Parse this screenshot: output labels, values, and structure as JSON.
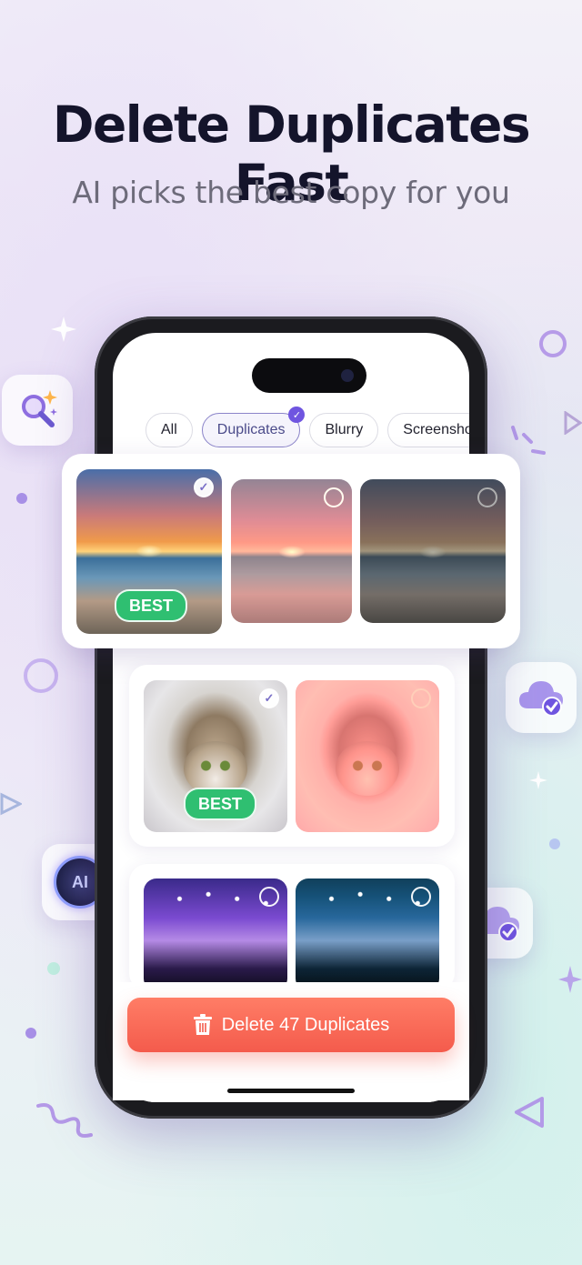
{
  "headline": "Delete Duplicates Fast",
  "subheadline": "AI picks the best copy for you",
  "filters": [
    {
      "label": "All",
      "active": false
    },
    {
      "label": "Duplicates",
      "active": true
    },
    {
      "label": "Blurry",
      "active": false
    },
    {
      "label": "Screenshots",
      "active": false
    }
  ],
  "groups": [
    {
      "subject": "sunset-beach",
      "best_label": "BEST",
      "selected_index": 0
    },
    {
      "subject": "cat",
      "best_label": "BEST",
      "selected_index": 0
    },
    {
      "subject": "concert"
    }
  ],
  "delete_button_label": "Delete 47 Duplicates",
  "ai_badge_label": "AI",
  "colors": {
    "accent_purple": "#6f55e0",
    "best_green": "#2fbf71",
    "delete_red": "#f45b4c",
    "title": "#14142b",
    "subtitle": "#6d6b7a"
  }
}
